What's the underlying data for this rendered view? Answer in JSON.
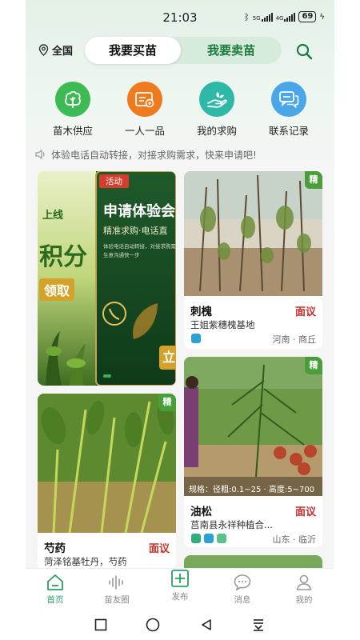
{
  "status": {
    "time": "21:03",
    "battery": "69"
  },
  "header": {
    "location": "全国",
    "tab_buy": "我要买苗",
    "tab_sell": "我要卖苗"
  },
  "quick_nav": [
    {
      "label": "苗木供应",
      "icon": "tree-icon",
      "color": "#3cba54"
    },
    {
      "label": "一人一品",
      "icon": "certificate-icon",
      "color": "#f07a1e"
    },
    {
      "label": "我的求购",
      "icon": "hand-seedling-icon",
      "color": "#2eb8a8"
    },
    {
      "label": "联系记录",
      "icon": "chat-icon",
      "color": "#4aa6e8"
    }
  ],
  "notice": "体验电话自动转接，对接求购需求，快来申请吧!",
  "banner": {
    "tag": "活动",
    "line_left_1": "上线",
    "line_left_2": "积分",
    "line_left_3": "领取",
    "title": "申请体验会",
    "subtitle": "精准求购·电话直",
    "desc_1": "体验电话自动转接，对接求购需求",
    "desc_2": "生意沟通快一步",
    "button": "立"
  },
  "products": [
    {
      "name": "刺槐",
      "price": "面议",
      "seller": "王姐紫穗槐基地",
      "location": "河南 · 商丘",
      "badge": "精"
    },
    {
      "name": "芍药",
      "price": "面议",
      "seller": "菏泽铭基牡丹，芍药",
      "location": "",
      "badge": "精"
    },
    {
      "name": "油松",
      "price": "面议",
      "seller": "莒南县永祥种植合...",
      "location": "山东 · 临沂",
      "badge": "精",
      "spec": "规格：径粗:0.1~25 · 高度:5~700"
    }
  ],
  "bottom_nav": [
    {
      "label": "首页",
      "active": true
    },
    {
      "label": "苗友圈",
      "active": false
    },
    {
      "label": "发布",
      "active": false
    },
    {
      "label": "消息",
      "active": false
    },
    {
      "label": "我的",
      "active": false
    }
  ],
  "colors": {
    "accent": "#1c7a3e",
    "price": "#c9302c",
    "active_tab": "#2aa060"
  }
}
